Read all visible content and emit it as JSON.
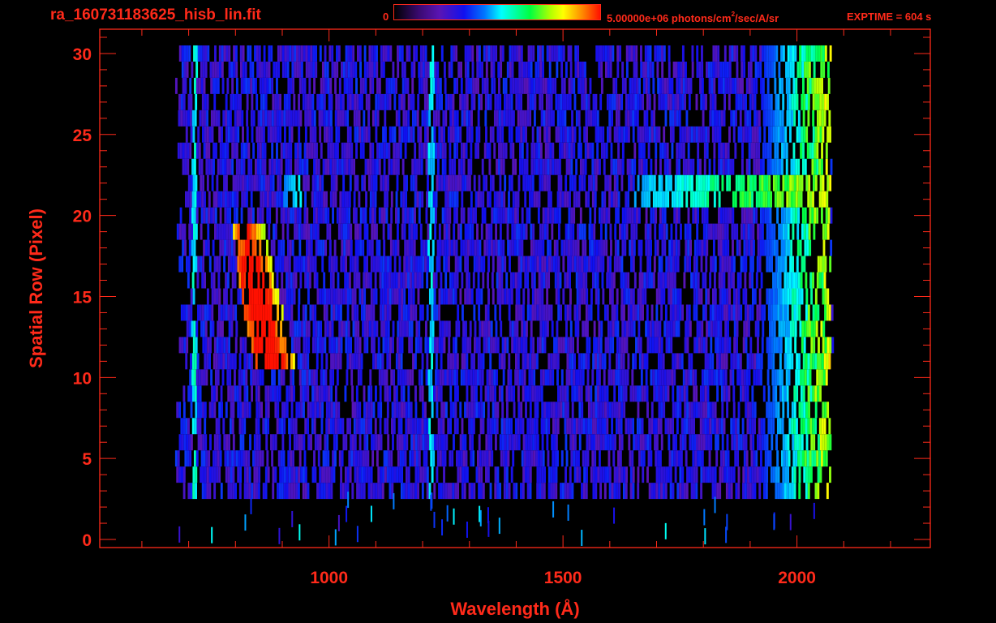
{
  "header": {
    "title": "ra_160731183625_hisb_lin.fit",
    "colorbar_min": "0",
    "colorbar_max": "5.00000e+06 photons/cm",
    "colorbar_max_sup": "2",
    "colorbar_max_tail": "/sec/A/sr",
    "exptime": "EXPTIME = 604 s"
  },
  "colors": {
    "axis": "#ff2a1a",
    "background": "#000000",
    "colormap": [
      "#000000",
      "#3a0a70",
      "#5a14b4",
      "#1010f0",
      "#0078ff",
      "#00ffff",
      "#00ff40",
      "#b4ff00",
      "#ffff00",
      "#ff8000",
      "#ff1000"
    ]
  },
  "chart_data": {
    "type": "heatmap",
    "title": "ra_160731183625_hisb_lin.fit",
    "xlabel": "Wavelength (Å)",
    "ylabel": "Spatial Row (Pixel)",
    "xlim": [
      510,
      2285
    ],
    "ylim": [
      -0.5,
      31.5
    ],
    "xticks": [
      1000,
      1500,
      2000
    ],
    "xtick_labels": [
      "1000",
      "1500",
      "2000"
    ],
    "yticks": [
      0,
      5,
      10,
      15,
      20,
      25,
      30
    ],
    "ytick_labels": [
      "0",
      "5",
      "10",
      "15",
      "20",
      "25",
      "30"
    ],
    "x_minor_step": 100,
    "y_minor_step": 1,
    "colorbar_range": [
      0,
      5000000
    ],
    "colorbar_unit": "photons/cm^2/sec/A/sr",
    "row_extent": [
      3,
      30
    ],
    "wavelength_extent": [
      685,
      2070
    ],
    "features": [
      {
        "kind": "blob",
        "x": [
          790,
          920
        ],
        "rows": [
          11,
          19
        ],
        "peak": 0.82
      },
      {
        "kind": "band",
        "x": [
          1650,
          2060
        ],
        "rows": [
          21,
          22
        ],
        "peak": 0.45
      },
      {
        "kind": "band",
        "x": [
          900,
          940
        ],
        "rows": [
          21,
          22
        ],
        "peak": 0.25
      },
      {
        "kind": "edge",
        "x": [
          1920,
          2070
        ],
        "rows": [
          3,
          30
        ],
        "peak": 0.55
      },
      {
        "kind": "line",
        "x": [
          705,
          715
        ],
        "rows": [
          3,
          30
        ],
        "peak": 0.25
      },
      {
        "kind": "line",
        "x": [
          1210,
          1222
        ],
        "rows": [
          3,
          30
        ],
        "peak": 0.22
      }
    ]
  }
}
